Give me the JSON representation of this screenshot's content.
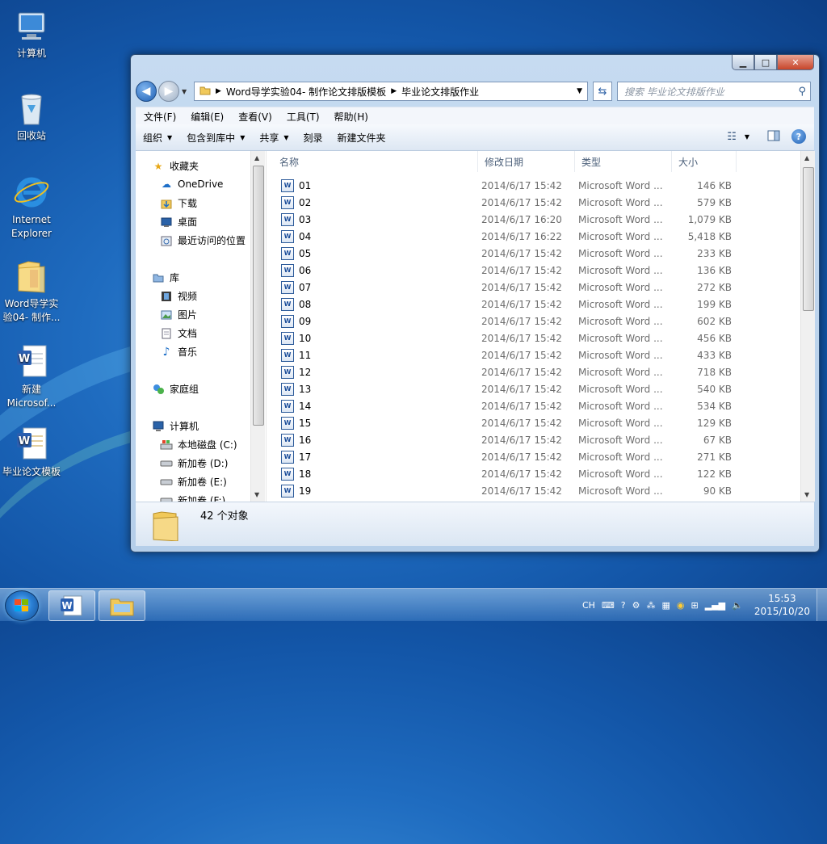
{
  "desktop": {
    "icons": [
      {
        "label": "计算机",
        "icon": "computer-icon"
      },
      {
        "label": "回收站",
        "icon": "recycle-bin-icon"
      },
      {
        "label": "Internet Explorer",
        "icon": "internet-explorer-icon"
      },
      {
        "label": "Word导学实验04- 制作...",
        "icon": "folder-icon"
      },
      {
        "label": "新建 Microsof...",
        "icon": "word-document-icon"
      },
      {
        "label": "毕业论文模板",
        "icon": "word-document-icon"
      }
    ]
  },
  "window": {
    "caption": {
      "minimize": "▁",
      "maximize": "□",
      "close": "✕"
    },
    "address": {
      "segments": [
        "Word导学实验04- 制作论文排版模板",
        "毕业论文排版作业"
      ]
    },
    "search": {
      "placeholder": "搜索 毕业论文排版作业"
    },
    "menu": [
      "文件(F)",
      "编辑(E)",
      "查看(V)",
      "工具(T)",
      "帮助(H)"
    ],
    "toolbar": {
      "organize": "组织",
      "include_library": "包含到库中",
      "share": "共享",
      "burn": "刻录",
      "new_folder": "新建文件夹",
      "help": "?"
    },
    "nav": {
      "favorites": "收藏夹",
      "onedrive": "OneDrive",
      "downloads": "下载",
      "desktop": "桌面",
      "recent": "最近访问的位置",
      "libraries": "库",
      "videos": "视频",
      "pictures": "图片",
      "documents": "文档",
      "music": "音乐",
      "homegroup": "家庭组",
      "computer": "计算机",
      "drive_c": "本地磁盘 (C:)",
      "drive_d": "新加卷 (D:)",
      "drive_e": "新加卷 (E:)",
      "drive_f": "新加卷 (F:)"
    },
    "columns": {
      "name": "名称",
      "date": "修改日期",
      "type": "类型",
      "size": "大小"
    },
    "files": [
      {
        "name": "01",
        "date": "2014/6/17 15:42",
        "type": "Microsoft Word ...",
        "size": "146 KB"
      },
      {
        "name": "02",
        "date": "2014/6/17 15:42",
        "type": "Microsoft Word ...",
        "size": "579 KB"
      },
      {
        "name": "03",
        "date": "2014/6/17 16:20",
        "type": "Microsoft Word ...",
        "size": "1,079 KB"
      },
      {
        "name": "04",
        "date": "2014/6/17 16:22",
        "type": "Microsoft Word ...",
        "size": "5,418 KB"
      },
      {
        "name": "05",
        "date": "2014/6/17 15:42",
        "type": "Microsoft Word ...",
        "size": "233 KB"
      },
      {
        "name": "06",
        "date": "2014/6/17 15:42",
        "type": "Microsoft Word ...",
        "size": "136 KB"
      },
      {
        "name": "07",
        "date": "2014/6/17 15:42",
        "type": "Microsoft Word ...",
        "size": "272 KB"
      },
      {
        "name": "08",
        "date": "2014/6/17 15:42",
        "type": "Microsoft Word ...",
        "size": "199 KB"
      },
      {
        "name": "09",
        "date": "2014/6/17 15:42",
        "type": "Microsoft Word ...",
        "size": "602 KB"
      },
      {
        "name": "10",
        "date": "2014/6/17 15:42",
        "type": "Microsoft Word ...",
        "size": "456 KB"
      },
      {
        "name": "11",
        "date": "2014/6/17 15:42",
        "type": "Microsoft Word ...",
        "size": "433 KB"
      },
      {
        "name": "12",
        "date": "2014/6/17 15:42",
        "type": "Microsoft Word ...",
        "size": "718 KB"
      },
      {
        "name": "13",
        "date": "2014/6/17 15:42",
        "type": "Microsoft Word ...",
        "size": "540 KB"
      },
      {
        "name": "14",
        "date": "2014/6/17 15:42",
        "type": "Microsoft Word ...",
        "size": "534 KB"
      },
      {
        "name": "15",
        "date": "2014/6/17 15:42",
        "type": "Microsoft Word ...",
        "size": "129 KB"
      },
      {
        "name": "16",
        "date": "2014/6/17 15:42",
        "type": "Microsoft Word ...",
        "size": "67 KB"
      },
      {
        "name": "17",
        "date": "2014/6/17 15:42",
        "type": "Microsoft Word ...",
        "size": "271 KB"
      },
      {
        "name": "18",
        "date": "2014/6/17 15:42",
        "type": "Microsoft Word ...",
        "size": "122 KB"
      },
      {
        "name": "19",
        "date": "2014/6/17 15:42",
        "type": "Microsoft Word ...",
        "size": "90 KB"
      }
    ],
    "status": {
      "count": "42 个对象"
    }
  },
  "taskbar": {
    "tray": {
      "lang": "CH",
      "time": "15:53",
      "date": "2015/10/20"
    }
  },
  "colors": {
    "accent": "#1d5fb4",
    "desktop": "#1f6cc0"
  }
}
